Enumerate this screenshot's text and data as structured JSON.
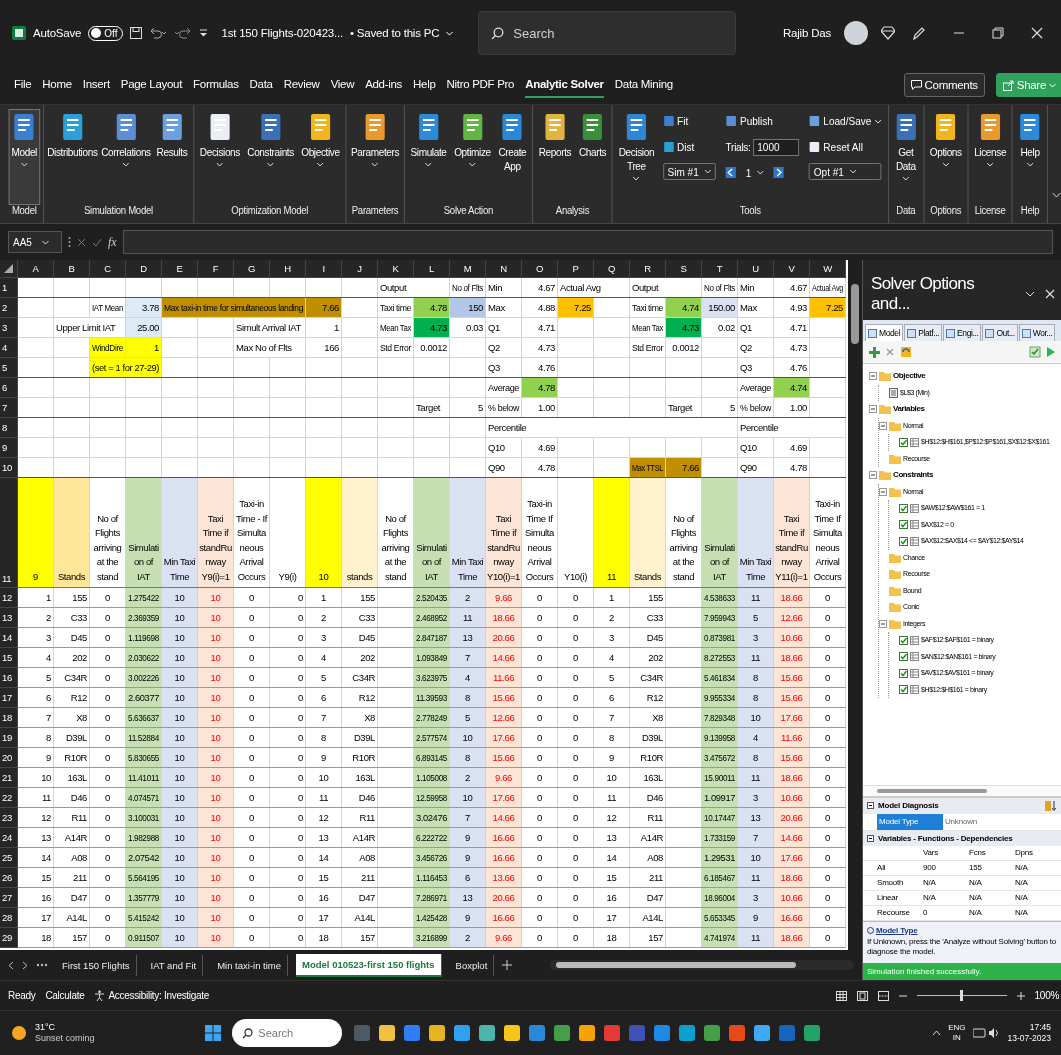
{
  "title_bar": {
    "autosave": {
      "label": "AutoSave",
      "on": false,
      "state_text": "Off"
    },
    "document": "1st 150 Flights-020423...",
    "save_status": "• Saved to this PC",
    "search": {
      "placeholder": "Search"
    },
    "user": "Rajib Das"
  },
  "menu": {
    "tabs": [
      {
        "label": "File",
        "selected": false
      },
      {
        "label": "Home",
        "selected": false
      },
      {
        "label": "Insert",
        "selected": false
      },
      {
        "label": "Page Layout",
        "selected": false
      },
      {
        "label": "Formulas",
        "selected": false
      },
      {
        "label": "Data",
        "selected": false
      },
      {
        "label": "Review",
        "selected": false
      },
      {
        "label": "View",
        "selected": false
      },
      {
        "label": "Add-ins",
        "selected": false
      },
      {
        "label": "Help",
        "selected": false
      },
      {
        "label": "Nitro PDF Pro",
        "selected": false
      },
      {
        "label": "Analytic Solver",
        "selected": true
      },
      {
        "label": "Data Mining",
        "selected": false
      }
    ],
    "comments": "Comments",
    "share": "Share"
  },
  "ribbon": {
    "groups": [
      {
        "label": "Model",
        "items": [
          {
            "kind": "large",
            "label": "Model",
            "menu": true
          }
        ]
      },
      {
        "label": "Simulation Model",
        "items": [
          {
            "kind": "large",
            "label": "Distributions",
            "menu": false
          },
          {
            "kind": "large",
            "label": "Correlations",
            "menu": true
          },
          {
            "kind": "large",
            "label": "Results",
            "menu": false
          }
        ]
      },
      {
        "label": "Optimization Model",
        "items": [
          {
            "kind": "large",
            "label": "Decisions",
            "menu": true
          },
          {
            "kind": "large",
            "label": "Constraints",
            "menu": true
          },
          {
            "kind": "large",
            "label": "Objective",
            "menu": true
          }
        ]
      },
      {
        "label": "Parameters",
        "items": [
          {
            "kind": "large",
            "label": "Parameters",
            "menu": true
          }
        ]
      },
      {
        "label": "Solve Action",
        "items": [
          {
            "kind": "large",
            "label": "Simulate",
            "menu": true
          },
          {
            "kind": "large",
            "label": "Optimize",
            "menu": true
          },
          {
            "kind": "large",
            "label": "Create App",
            "menu": false
          }
        ]
      },
      {
        "label": "Analysis",
        "items": [
          {
            "kind": "large",
            "label": "Reports",
            "menu": false
          },
          {
            "kind": "large",
            "label": "Charts",
            "menu": false
          }
        ]
      },
      {
        "label": "Tools",
        "items": [
          {
            "kind": "large",
            "label": "Decision Tree",
            "menu": true
          },
          {
            "kind": "stack",
            "rows": [
              {
                "kind": "small",
                "label": "Fit",
                "menu": false
              },
              {
                "kind": "small",
                "label": "Dist",
                "menu": false
              },
              {
                "kind": "dropdown",
                "label": "Sim #1"
              }
            ]
          },
          {
            "kind": "stack",
            "rows": [
              {
                "kind": "small",
                "label": "Publish",
                "menu": false
              },
              {
                "kind": "field",
                "label": "Trials:",
                "value": "1000"
              },
              {
                "kind": "spinner",
                "value": "1"
              }
            ]
          },
          {
            "kind": "stack",
            "rows": [
              {
                "kind": "small",
                "label": "Load/Save",
                "menu": true
              },
              {
                "kind": "small",
                "label": "Reset All",
                "menu": false
              },
              {
                "kind": "dropdown",
                "label": "Opt #1"
              }
            ]
          }
        ]
      },
      {
        "label": "Data",
        "items": [
          {
            "kind": "large",
            "label": "Get Data",
            "menu": true
          }
        ]
      },
      {
        "label": "Options",
        "items": [
          {
            "kind": "large",
            "label": "Options",
            "menu": true
          }
        ]
      },
      {
        "label": "License",
        "items": [
          {
            "kind": "large",
            "label": "License",
            "menu": true
          }
        ]
      },
      {
        "label": "Help",
        "items": [
          {
            "kind": "large",
            "label": "Help",
            "menu": true
          }
        ]
      }
    ]
  },
  "formula_bar": {
    "name_box": "AA5",
    "function_label": "fx"
  },
  "sheet": {
    "columns": [
      {
        "letter": "A",
        "header": {
          "text": "9",
          "color": "#ffff00"
        }
      },
      {
        "letter": "B",
        "header": {
          "text": "Stands",
          "color": "#ffe699"
        }
      },
      {
        "letter": "C",
        "header": {
          "text": "No of Flights arriving at the stand"
        }
      },
      {
        "letter": "D",
        "header": {
          "text": "Simulation of IAT",
          "color": "#c6e0b4"
        },
        "color": "#c6e0b4"
      },
      {
        "letter": "E",
        "header": {
          "text": "Min Taxi Time",
          "color": "#d9e1f2"
        },
        "color": "#d9e1f2"
      },
      {
        "letter": "F",
        "header": {
          "text": "Taxi Time if standRunway Y9(i)=1",
          "color": "#fce4d6"
        },
        "color": "#fce4d6",
        "alert": true
      },
      {
        "letter": "G",
        "header": {
          "text": "Taxi-in Time - If Simultaneous Arrival Occurs"
        }
      },
      {
        "letter": "H",
        "header": {
          "text": "Y9(i)"
        }
      },
      {
        "letter": "I",
        "header": {
          "text": "10",
          "color": "#ffff00"
        }
      },
      {
        "letter": "J",
        "header": {
          "text": "stands",
          "color": "#fff2cc"
        }
      },
      {
        "letter": "K",
        "header": {
          "text": "No of Flights arriving at the stand"
        }
      },
      {
        "letter": "L",
        "header": {
          "text": "Simulation of IAT",
          "color": "#c6e0b4"
        },
        "color": "#c6e0b4"
      },
      {
        "letter": "M",
        "header": {
          "text": "Min Taxi Time",
          "color": "#d9e1f2"
        },
        "color": "#d9e1f2"
      },
      {
        "letter": "N",
        "header": {
          "text": "Taxi Time if standRunway Y10(i)=1",
          "color": "#fce4d6"
        },
        "color": "#fce4d6",
        "alert": true
      },
      {
        "letter": "O",
        "header": {
          "text": "Taxi-in Time If Simultaneous Arrival Occurs"
        }
      },
      {
        "letter": "P",
        "header": {
          "text": "Y10(i)"
        }
      },
      {
        "letter": "Q",
        "header": {
          "text": "11",
          "color": "#ffff00"
        }
      },
      {
        "letter": "R",
        "header": {
          "text": "Stands",
          "color": "#fff2cc"
        }
      },
      {
        "letter": "S",
        "header": {
          "text": "No of Flights arriving at the stand"
        }
      },
      {
        "letter": "T",
        "header": {
          "text": "Simulation of IAT",
          "color": "#c6e0b4"
        },
        "color": "#c6e0b4"
      },
      {
        "letter": "U",
        "header": {
          "text": "Min Taxi Time",
          "color": "#d9e1f2"
        },
        "color": "#d9e1f2"
      },
      {
        "letter": "V",
        "header": {
          "text": "Taxi Time if standRunway Y11(i)=1",
          "color": "#fce4d6"
        },
        "color": "#fce4d6",
        "alert": true
      },
      {
        "letter": "W",
        "header": {
          "text": "Taxi-in Time If Simultaneous Arrival Occurs"
        }
      }
    ],
    "top_rows": [
      {
        "row_number": "1",
        "cells": [
          null,
          null,
          null,
          null,
          null,
          null,
          null,
          null,
          null,
          null,
          {
            "text": "Output",
            "kind": "text"
          },
          null,
          {
            "text": "No of Flts",
            "kind": "text"
          },
          {
            "text": "Min",
            "kind": "text"
          },
          {
            "text": "4.67",
            "kind": "number"
          },
          {
            "text": "Actual Avg",
            "kind": "text"
          },
          null,
          {
            "text": "Output",
            "kind": "text"
          },
          null,
          {
            "text": "No of Flts",
            "kind": "text"
          },
          {
            "text": "Min",
            "kind": "text"
          },
          {
            "text": "4.67",
            "kind": "number"
          },
          {
            "text": "Actual Avg",
            "kind": "text"
          }
        ]
      },
      {
        "row_number": "2",
        "cells": [
          null,
          null,
          {
            "text": "IAT Mean",
            "kind": "text"
          },
          {
            "text": "3.78",
            "kind": "number",
            "color": "#ddebf7"
          },
          {
            "text": "Max taxi-in time for simultaneous landing",
            "kind": "text",
            "color": "#bf8f00"
          },
          {
            "kind": "fill",
            "color": "#bf8f00"
          },
          {
            "kind": "fill",
            "color": "#bf8f00"
          },
          {
            "kind": "fill",
            "color": "#bf8f00"
          },
          {
            "text": "7.66",
            "kind": "number",
            "color": "#bf8f00"
          },
          null,
          {
            "text": "Taxi time",
            "kind": "text"
          },
          {
            "text": "4.78",
            "kind": "number",
            "color": "#92d050"
          },
          {
            "text": "150",
            "kind": "number",
            "color": "#b4c6e7"
          },
          {
            "text": "Max",
            "kind": "text"
          },
          {
            "text": "4.88",
            "kind": "number"
          },
          {
            "text": "7.25",
            "kind": "number",
            "color": "#ffc000"
          },
          null,
          {
            "text": "Taxi time",
            "kind": "text"
          },
          {
            "text": "4.74",
            "kind": "number",
            "color": "#92d050"
          },
          {
            "text": "150.00",
            "kind": "number",
            "color": "#d9e1f2"
          },
          {
            "text": "Max",
            "kind": "text"
          },
          {
            "text": "4.93",
            "kind": "number"
          },
          {
            "text": "7.25",
            "kind": "number",
            "color": "#ffc000"
          }
        ]
      },
      {
        "row_number": "3",
        "cells": [
          null,
          {
            "text": "Upper Limit IAT",
            "kind": "text"
          },
          null,
          {
            "text": "25.00",
            "kind": "number",
            "color": "#ddebf7"
          },
          null,
          null,
          {
            "text": "Simult Arrival IAT",
            "kind": "text"
          },
          null,
          {
            "text": "1",
            "kind": "number"
          },
          null,
          {
            "text": "Mean Tax",
            "kind": "text"
          },
          {
            "text": "4.73",
            "kind": "number",
            "color": "#00b050"
          },
          {
            "text": "0.03",
            "kind": "number"
          },
          {
            "text": "Q1",
            "kind": "text"
          },
          {
            "text": "4.71",
            "kind": "number"
          },
          null,
          null,
          {
            "text": "Mean Tax",
            "kind": "text"
          },
          {
            "text": "4.73",
            "kind": "number",
            "color": "#00b050"
          },
          {
            "text": "0.02",
            "kind": "number"
          },
          {
            "text": "Q1",
            "kind": "text"
          },
          {
            "text": "4.71",
            "kind": "number"
          },
          null
        ]
      },
      {
        "row_number": "4",
        "cells": [
          null,
          null,
          {
            "text": "WindDire",
            "kind": "text",
            "color": "#ffff00"
          },
          {
            "text": "1",
            "kind": "number",
            "color": "#ffff00"
          },
          null,
          null,
          {
            "text": "Max No of Flts",
            "kind": "text"
          },
          null,
          {
            "text": "166",
            "kind": "number"
          },
          null,
          {
            "text": "Std Error",
            "kind": "text"
          },
          {
            "text": "0.0012",
            "kind": "number"
          },
          null,
          {
            "text": "Q2",
            "kind": "text"
          },
          {
            "text": "4.73",
            "kind": "number"
          },
          null,
          null,
          {
            "text": "Std Error",
            "kind": "text"
          },
          {
            "text": "0.0012",
            "kind": "number"
          },
          null,
          {
            "text": "Q2",
            "kind": "text"
          },
          {
            "text": "4.73",
            "kind": "number"
          },
          null
        ]
      },
      {
        "row_number": "5",
        "cells": [
          null,
          null,
          {
            "text": "(set = 1 for 27-29)",
            "kind": "text",
            "color": "#ffff00"
          },
          {
            "kind": "fill",
            "color": "#ffff00"
          },
          null,
          null,
          null,
          null,
          null,
          null,
          null,
          null,
          null,
          {
            "text": "Q3",
            "kind": "text"
          },
          {
            "text": "4.76",
            "kind": "number"
          },
          null,
          null,
          null,
          null,
          null,
          {
            "text": "Q3",
            "kind": "text"
          },
          {
            "text": "4.76",
            "kind": "number"
          },
          null
        ]
      },
      {
        "row_number": "6",
        "cells": [
          null,
          null,
          null,
          null,
          null,
          null,
          null,
          null,
          null,
          null,
          null,
          null,
          null,
          {
            "text": "Average",
            "kind": "text"
          },
          {
            "text": "4.78",
            "kind": "number",
            "color": "#92d050"
          },
          null,
          null,
          null,
          null,
          null,
          {
            "text": "Average",
            "kind": "text"
          },
          {
            "text": "4.74",
            "kind": "number",
            "color": "#92d050"
          },
          null
        ]
      },
      {
        "row_number": "7",
        "cells": [
          null,
          null,
          null,
          null,
          null,
          null,
          null,
          null,
          null,
          null,
          null,
          {
            "text": "Target",
            "kind": "text"
          },
          {
            "text": "5",
            "kind": "number"
          },
          {
            "text": "% below",
            "kind": "text"
          },
          {
            "text": "1.00",
            "kind": "number"
          },
          null,
          null,
          null,
          {
            "text": "Target",
            "kind": "text"
          },
          {
            "text": "5",
            "kind": "number"
          },
          {
            "text": "% below",
            "kind": "text"
          },
          {
            "text": "1.00",
            "kind": "number"
          },
          null
        ]
      },
      {
        "row_number": "8",
        "cells": [
          null,
          null,
          null,
          null,
          null,
          null,
          null,
          null,
          null,
          null,
          null,
          null,
          null,
          {
            "text": "Percentile",
            "kind": "text"
          },
          null,
          null,
          null,
          null,
          null,
          null,
          {
            "text": "Percentile",
            "kind": "text"
          },
          null,
          null
        ]
      },
      {
        "row_number": "9",
        "cells": [
          null,
          null,
          null,
          null,
          null,
          null,
          null,
          null,
          null,
          null,
          null,
          null,
          null,
          {
            "text": "Q10",
            "kind": "text"
          },
          {
            "text": "4.69",
            "kind": "number"
          },
          null,
          null,
          null,
          null,
          null,
          {
            "text": "Q10",
            "kind": "text"
          },
          {
            "text": "4.69",
            "kind": "number"
          },
          null
        ]
      },
      {
        "row_number": "10",
        "cells": [
          null,
          null,
          null,
          null,
          null,
          null,
          null,
          null,
          null,
          null,
          null,
          null,
          null,
          {
            "text": "Q90",
            "kind": "text"
          },
          {
            "text": "4.78",
            "kind": "number"
          },
          null,
          null,
          {
            "text": "Max TTSL",
            "kind": "text",
            "color": "#bf8f00"
          },
          {
            "text": "7.66",
            "kind": "number",
            "color": "#bf8f00"
          },
          null,
          {
            "text": "Q90",
            "kind": "text"
          },
          {
            "text": "4.78",
            "kind": "number"
          },
          null
        ]
      }
    ],
    "header_row_number": "11",
    "rows": [
      {
        "row_number": "12",
        "cells": [
          "1",
          "155",
          "0",
          "1.275422",
          "10",
          "10",
          "0",
          "0",
          "1",
          "155",
          null,
          "2.520435",
          "2",
          "9.66",
          "0",
          "0",
          "1",
          "155",
          null,
          "4.538633",
          "11",
          "18.66",
          "0"
        ]
      },
      {
        "row_number": "13",
        "cells": [
          "2",
          "C33",
          "0",
          "2.369359",
          "10",
          "10",
          "0",
          "0",
          "2",
          "C33",
          null,
          "2.468952",
          "11",
          "18.66",
          "0",
          "0",
          "2",
          "C33",
          null,
          "7.959943",
          "5",
          "12.66",
          "0"
        ]
      },
      {
        "row_number": "14",
        "cells": [
          "3",
          "D45",
          "0",
          "1.119698",
          "10",
          "10",
          "0",
          "0",
          "3",
          "D45",
          null,
          "2.847187",
          "13",
          "20.66",
          "0",
          "0",
          "3",
          "D45",
          null,
          "0.873981",
          "3",
          "10.66",
          "0"
        ]
      },
      {
        "row_number": "15",
        "cells": [
          "4",
          "202",
          "0",
          "2.030622",
          "10",
          "10",
          "0",
          "0",
          "4",
          "202",
          null,
          "1.093849",
          "7",
          "14.66",
          "0",
          "0",
          "4",
          "202",
          null,
          "8.272553",
          "11",
          "18.66",
          "0"
        ]
      },
      {
        "row_number": "16",
        "cells": [
          "5",
          "C34R",
          "0",
          "3.002226",
          "10",
          "10",
          "0",
          "0",
          "5",
          "C34R",
          null,
          "3.623975",
          "4",
          "11.66",
          "0",
          "0",
          "5",
          "C34R",
          null,
          "5.461834",
          "8",
          "15.66",
          "0"
        ]
      },
      {
        "row_number": "17",
        "cells": [
          "6",
          "R12",
          "0",
          "2.60377",
          "10",
          "10",
          "0",
          "0",
          "6",
          "R12",
          null,
          "11.39593",
          "8",
          "15.66",
          "0",
          "0",
          "6",
          "R12",
          null,
          "9.955334",
          "8",
          "15.66",
          "0"
        ]
      },
      {
        "row_number": "18",
        "cells": [
          "7",
          "X8",
          "0",
          "5.636637",
          "10",
          "10",
          "0",
          "0",
          "7",
          "X8",
          null,
          "2.778249",
          "5",
          "12.66",
          "0",
          "0",
          "7",
          "X8",
          null,
          "7.829348",
          "10",
          "17.66",
          "0"
        ]
      },
      {
        "row_number": "19",
        "cells": [
          "8",
          "D39L",
          "0",
          "11.52884",
          "10",
          "10",
          "0",
          "0",
          "8",
          "D39L",
          null,
          "2.577574",
          "10",
          "17.66",
          "0",
          "0",
          "8",
          "D39L",
          null,
          "9.139958",
          "4",
          "11.66",
          "0"
        ]
      },
      {
        "row_number": "20",
        "cells": [
          "9",
          "R10R",
          "0",
          "5.830655",
          "10",
          "10",
          "0",
          "0",
          "9",
          "R10R",
          null,
          "6.893145",
          "8",
          "15.66",
          "0",
          "0",
          "9",
          "R10R",
          null,
          "3.475672",
          "8",
          "15.66",
          "0"
        ]
      },
      {
        "row_number": "21",
        "cells": [
          "10",
          "163L",
          "0",
          "11.41011",
          "10",
          "10",
          "0",
          "0",
          "10",
          "163L",
          null,
          "1.105008",
          "2",
          "9.66",
          "0",
          "0",
          "10",
          "163L",
          null,
          "15.90011",
          "11",
          "18.66",
          "0"
        ]
      },
      {
        "row_number": "22",
        "cells": [
          "11",
          "D46",
          "0",
          "4.074571",
          "10",
          "10",
          "0",
          "0",
          "11",
          "D46",
          null,
          "12.59958",
          "10",
          "17.66",
          "0",
          "0",
          "11",
          "D46",
          null,
          "1.09917",
          "3",
          "10.66",
          "0"
        ]
      },
      {
        "row_number": "23",
        "cells": [
          "12",
          "R11",
          "0",
          "3.100031",
          "10",
          "10",
          "0",
          "0",
          "12",
          "R11",
          null,
          "3.02476",
          "7",
          "14.66",
          "0",
          "0",
          "12",
          "R11",
          null,
          "10.17447",
          "13",
          "20.66",
          "0"
        ]
      },
      {
        "row_number": "24",
        "cells": [
          "13",
          "A14R",
          "0",
          "1.982988",
          "10",
          "10",
          "0",
          "0",
          "13",
          "A14R",
          null,
          "6.222722",
          "9",
          "16.66",
          "0",
          "0",
          "13",
          "A14R",
          null,
          "1.733159",
          "7",
          "14.66",
          "0"
        ]
      },
      {
        "row_number": "25",
        "cells": [
          "14",
          "A08",
          "0",
          "2.07542",
          "10",
          "10",
          "0",
          "0",
          "14",
          "A08",
          null,
          "3.456726",
          "9",
          "16.66",
          "0",
          "0",
          "14",
          "A08",
          null,
          "1.29531",
          "10",
          "17.66",
          "0"
        ]
      },
      {
        "row_number": "26",
        "cells": [
          "15",
          "211",
          "0",
          "5.564195",
          "10",
          "10",
          "0",
          "0",
          "15",
          "211",
          null,
          "1.116453",
          "6",
          "13.66",
          "0",
          "0",
          "15",
          "211",
          null,
          "6.185467",
          "11",
          "18.66",
          "0"
        ]
      },
      {
        "row_number": "27",
        "cells": [
          "16",
          "D47",
          "0",
          "1.357779",
          "10",
          "10",
          "0",
          "0",
          "16",
          "D47",
          null,
          "7.286971",
          "13",
          "20.66",
          "0",
          "0",
          "16",
          "D47",
          null,
          "18.96004",
          "3",
          "10.66",
          "0"
        ]
      },
      {
        "row_number": "28",
        "cells": [
          "17",
          "A14L",
          "0",
          "5.415242",
          "10",
          "10",
          "0",
          "0",
          "17",
          "A14L",
          null,
          "1.425428",
          "9",
          "16.66",
          "0",
          "0",
          "17",
          "A14L",
          null,
          "5.653345",
          "9",
          "16.66",
          "0"
        ]
      },
      {
        "row_number": "29",
        "cells": [
          "18",
          "157",
          "0",
          "0.911507",
          "10",
          "10",
          "0",
          "0",
          "18",
          "157",
          null,
          "3.216899",
          "2",
          "9.66",
          "0",
          "0",
          "18",
          "157",
          null,
          "4.741974",
          "11",
          "18.66",
          "0"
        ]
      }
    ]
  },
  "sheet_tabs": [
    {
      "label": "First 150 Flights",
      "selected": false
    },
    {
      "label": "IAT and Fit",
      "selected": false
    },
    {
      "label": "Min taxi-in time",
      "selected": false
    },
    {
      "label": "Model 010523-first 150 flights",
      "selected": true
    },
    {
      "label": "Boxplot",
      "selected": false
    }
  ],
  "solver": {
    "title": "Solver Options and...",
    "tabs": [
      {
        "label": "Model",
        "selected": true
      },
      {
        "label": "Platf...",
        "selected": false
      },
      {
        "label": "Engi...",
        "selected": false
      },
      {
        "label": "Out...",
        "selected": false
      },
      {
        "label": "Wor...",
        "selected": false
      }
    ],
    "tree": [
      {
        "label": "Objective",
        "kind": "folder",
        "expanded": true,
        "children": [
          {
            "label": "$L$3 (Min)",
            "kind": "objective"
          }
        ]
      },
      {
        "label": "Variables",
        "kind": "folder",
        "expanded": true,
        "children": [
          {
            "label": "Normal",
            "kind": "folder",
            "expanded": true,
            "children": [
              {
                "label": "$H$12:$H$161,$P$12:$P$161,$X$12:$X$161",
                "kind": "entry",
                "checked": true
              }
            ]
          },
          {
            "label": "Recourse",
            "kind": "folder"
          }
        ]
      },
      {
        "label": "Constraints",
        "kind": "folder",
        "expanded": true,
        "children": [
          {
            "label": "Normal",
            "kind": "folder",
            "expanded": true,
            "children": [
              {
                "label": "$AW$12:$AW$161 = 1",
                "kind": "entry",
                "checked": true
              },
              {
                "label": "$AX$12 = 0",
                "kind": "entry",
                "checked": true
              },
              {
                "label": "$AX$12:$AX$14 <= $AY$12:$AY$14",
                "kind": "entry",
                "checked": true
              }
            ]
          },
          {
            "label": "Chance",
            "kind": "folder"
          },
          {
            "label": "Recourse",
            "kind": "folder"
          },
          {
            "label": "Bound",
            "kind": "folder"
          },
          {
            "label": "Conic",
            "kind": "folder"
          },
          {
            "label": "Integers",
            "kind": "folder",
            "expanded": true,
            "children": [
              {
                "label": "$AF$12:$AF$161 = binary",
                "kind": "entry",
                "checked": true
              },
              {
                "label": "$AN$12:$AN$161 = binary",
                "kind": "entry",
                "checked": true
              },
              {
                "label": "$AV$12:$AV$161 = binary",
                "kind": "entry",
                "checked": true
              },
              {
                "label": "$H$12:$H$161 = binary",
                "kind": "entry",
                "checked": true
              }
            ]
          }
        ]
      }
    ],
    "diagnosis": {
      "title": "Model Diagnosis",
      "rows": [
        {
          "label": "Model Type",
          "value": "Unknown",
          "selected": true
        }
      ]
    },
    "dependencies": {
      "title": "Variables - Functions - Dependencies",
      "columns": [
        "Vars",
        "Fcns",
        "Dpns"
      ],
      "rows": [
        {
          "label": "All",
          "values": [
            "900",
            "155",
            "N/A"
          ]
        },
        {
          "label": "Smooth",
          "values": [
            "N/A",
            "N/A",
            "N/A"
          ]
        },
        {
          "label": "Linear",
          "values": [
            "N/A",
            "N/A",
            "N/A"
          ]
        },
        {
          "label": "Recourse",
          "values": [
            "0",
            "N/A",
            "N/A"
          ]
        }
      ]
    },
    "help": {
      "title": "Model Type",
      "text": "If Unknown, press the 'Analyze without Solving' button to diagnose the model."
    },
    "status": "Simulation finished successfully."
  },
  "status_bar": {
    "mode": "Ready",
    "calculate": "Calculate",
    "accessibility": "Accessibility: Investigate",
    "zoom": {
      "level": 0.5,
      "reading": "100%"
    }
  },
  "taskbar": {
    "weather": {
      "temperature": "31°C",
      "note": "Sunset coming"
    },
    "search": {
      "placeholder": "Search"
    },
    "language": "ENG",
    "region": "IN",
    "time": "17:45",
    "date": "13-07-2023"
  }
}
